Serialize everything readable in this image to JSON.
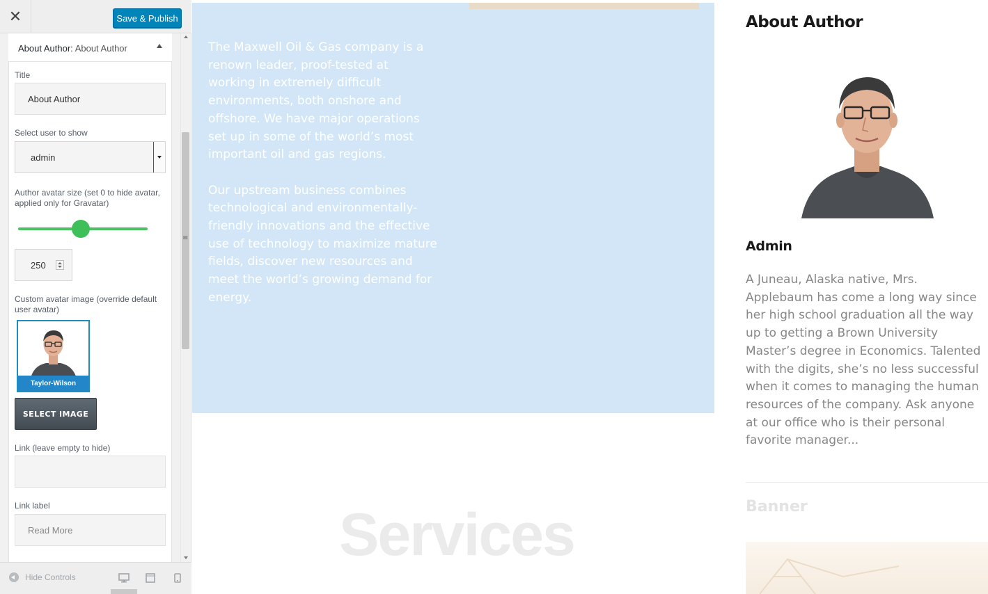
{
  "header": {
    "close_symbol": "✕",
    "publish_label": "Save & Publish"
  },
  "section": {
    "prefix": "About Author:",
    "name": "About Author"
  },
  "fields": {
    "title_label": "Title",
    "title_value": "About Author",
    "user_label": "Select user to show",
    "user_value": "admin",
    "avatar_size_label": "Author avatar size (set 0 to hide avatar, applied only for Gravatar)",
    "avatar_size_value": "250",
    "custom_avatar_label": "Custom avatar image (override default user avatar)",
    "custom_avatar_caption": "Taylor-Wilson",
    "select_image_label": "SELECT IMAGE",
    "link_label": "Link (leave empty to hide)",
    "link_value": "",
    "link_text_label": "Link label",
    "link_text_value": "Read More"
  },
  "slider": {
    "value_fraction": 0.5,
    "color": "#4cc164"
  },
  "footer": {
    "hide_controls_label": "Hide Controls",
    "devices": [
      "desktop-icon",
      "tablet-icon",
      "mobile-icon"
    ]
  },
  "preview": {
    "hero_paragraphs": [
      "The Maxwell Oil & Gas company is a renown leader, proof-tested at working in extremely difficult environments, both onshore and offshore. We have major operations set up in some of the world’s most important oil and gas regions.",
      "Our upstream business combines technological and environmentally-friendly innovations and the effective use of technology to maximize mature fields, discover new resources and meet the world’s growing demand for energy."
    ],
    "services_heading": "Services",
    "widget_title": "About Author",
    "author_name": "Admin",
    "author_bio": "A Juneau, Alaska native, Mrs. Applebaum has come a long way since her high school graduation all the way up to getting a Brown University Master’s degree in Economics. Talented with the digits, she’s no less successful when it comes to managing the human resources of the company. Ask anyone at our office who is their personal favorite manager...",
    "banner_title": "Banner"
  },
  "colors": {
    "accent": "#0085ba",
    "hero_background": "#d2e6f7",
    "thumbnail_caption": "#2386c8"
  }
}
